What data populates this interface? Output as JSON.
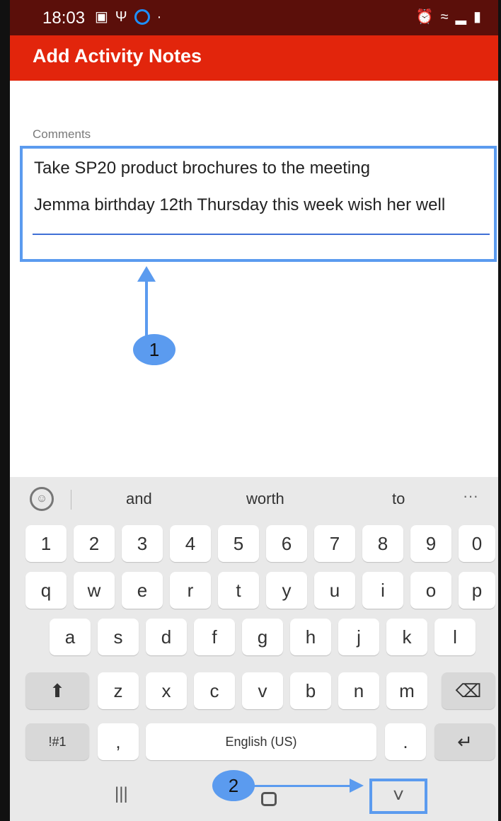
{
  "status_bar": {
    "time": "18:03",
    "left_icons": [
      "image-icon",
      "usb-icon",
      "circle-notification-icon",
      "dot-icon"
    ],
    "right_icons": [
      "alarm-icon",
      "wifi-icon",
      "signal-icon",
      "battery-icon"
    ]
  },
  "app_bar": {
    "title": "Add Activity Notes",
    "color": "#e2250c"
  },
  "form": {
    "comments_label": "Comments",
    "comments_line1": "Take SP20 product brochures to the meeting",
    "comments_line2": "Jemma birthday 12th Thursday this week wish her well"
  },
  "callouts": {
    "one": "1",
    "two": "2",
    "color": "#5b9bef"
  },
  "keyboard": {
    "suggestions": [
      "and",
      "worth",
      "to"
    ],
    "more": "···",
    "emoji_glyph": "☺",
    "number_row": [
      "1",
      "2",
      "3",
      "4",
      "5",
      "6",
      "7",
      "8",
      "9",
      "0"
    ],
    "row1": [
      "q",
      "w",
      "e",
      "r",
      "t",
      "y",
      "u",
      "i",
      "o",
      "p"
    ],
    "row2": [
      "a",
      "s",
      "d",
      "f",
      "g",
      "h",
      "j",
      "k",
      "l"
    ],
    "row3": [
      "z",
      "x",
      "c",
      "v",
      "b",
      "n",
      "m"
    ],
    "shift_glyph": "⬆",
    "backspace_glyph": "⌫",
    "symbols": "!#1",
    "comma": ",",
    "space": "English (US)",
    "period": ".",
    "enter_glyph": "↵"
  },
  "nav_bar": {
    "recent": "|||",
    "hide_keyboard": "˅"
  }
}
